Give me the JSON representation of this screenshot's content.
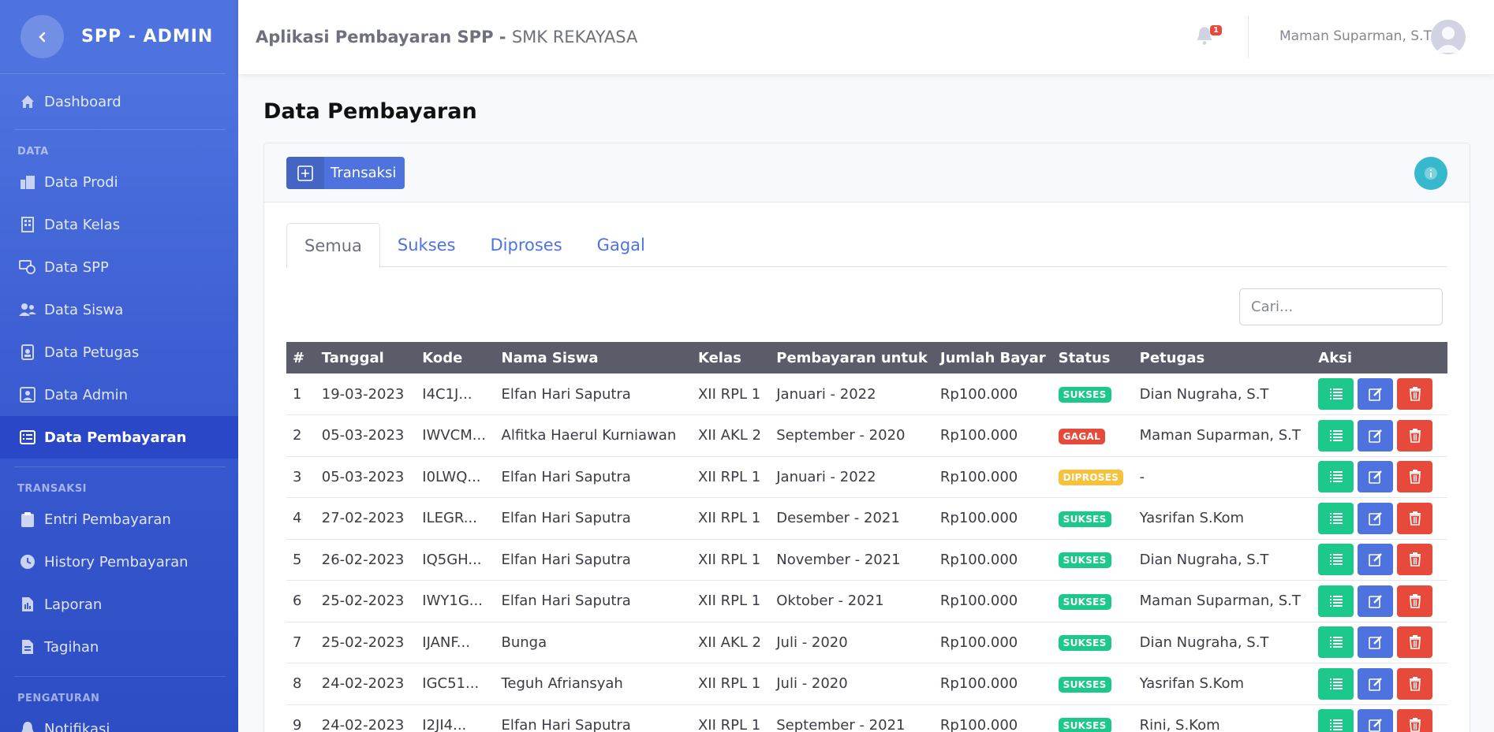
{
  "sidebar": {
    "brand": "SPP - ADMIN",
    "dashboard": "Dashboard",
    "heading_data": "DATA",
    "data_items": [
      "Data Prodi",
      "Data Kelas",
      "Data SPP",
      "Data Siswa",
      "Data Petugas",
      "Data Admin",
      "Data Pembayaran"
    ],
    "heading_transaksi": "TRANSAKSI",
    "transaksi_items": [
      "Entri Pembayaran",
      "History Pembayaran",
      "Laporan",
      "Tagihan"
    ],
    "heading_pengaturan": "PENGATURAN",
    "pengaturan_items": [
      "Notifikasi"
    ]
  },
  "topbar": {
    "app_title_bold": "Aplikasi Pembayaran SPP",
    "app_title_sep": " - ",
    "app_title_school": "SMK REKAYASA",
    "notification_count": "1",
    "username": "Maman Suparman, S.T"
  },
  "main": {
    "page_title": "Data Pembayaran",
    "transaksi_button": "Transaksi",
    "tabs": [
      "Semua",
      "Sukses",
      "Diproses",
      "Gagal"
    ],
    "search_placeholder": "Cari...",
    "columns": [
      "#",
      "Tanggal",
      "Kode",
      "Nama Siswa",
      "Kelas",
      "Pembayaran untuk",
      "Jumlah Bayar",
      "Status",
      "Petugas",
      "Aksi"
    ],
    "rows": [
      {
        "no": "1",
        "tanggal": "19-03-2023",
        "kode": "I4C1J...",
        "nama": "Elfan Hari Saputra",
        "kelas": "XII RPL 1",
        "untuk": "Januari - 2022",
        "jumlah": "Rp100.000",
        "status": "SUKSES",
        "petugas": "Dian Nugraha, S.T"
      },
      {
        "no": "2",
        "tanggal": "05-03-2023",
        "kode": "IWVCM...",
        "nama": "Alfitka Haerul Kurniawan",
        "kelas": "XII AKL 2",
        "untuk": "September - 2020",
        "jumlah": "Rp100.000",
        "status": "GAGAL",
        "petugas": "Maman Suparman, S.T"
      },
      {
        "no": "3",
        "tanggal": "05-03-2023",
        "kode": "I0LWQ...",
        "nama": "Elfan Hari Saputra",
        "kelas": "XII RPL 1",
        "untuk": "Januari - 2022",
        "jumlah": "Rp100.000",
        "status": "DIPROSES",
        "petugas": "-"
      },
      {
        "no": "4",
        "tanggal": "27-02-2023",
        "kode": "ILEGR...",
        "nama": "Elfan Hari Saputra",
        "kelas": "XII RPL 1",
        "untuk": "Desember - 2021",
        "jumlah": "Rp100.000",
        "status": "SUKSES",
        "petugas": "Yasrifan S.Kom"
      },
      {
        "no": "5",
        "tanggal": "26-02-2023",
        "kode": "IQ5GH...",
        "nama": "Elfan Hari Saputra",
        "kelas": "XII RPL 1",
        "untuk": "November - 2021",
        "jumlah": "Rp100.000",
        "status": "SUKSES",
        "petugas": "Dian Nugraha, S.T"
      },
      {
        "no": "6",
        "tanggal": "25-02-2023",
        "kode": "IWY1G...",
        "nama": "Elfan Hari Saputra",
        "kelas": "XII RPL 1",
        "untuk": "Oktober - 2021",
        "jumlah": "Rp100.000",
        "status": "SUKSES",
        "petugas": "Maman Suparman, S.T"
      },
      {
        "no": "7",
        "tanggal": "25-02-2023",
        "kode": "IJANF...",
        "nama": "Bunga",
        "kelas": "XII AKL 2",
        "untuk": "Juli - 2020",
        "jumlah": "Rp100.000",
        "status": "SUKSES",
        "petugas": "Dian Nugraha, S.T"
      },
      {
        "no": "8",
        "tanggal": "24-02-2023",
        "kode": "IGC51...",
        "nama": "Teguh Afriansyah",
        "kelas": "XII RPL 1",
        "untuk": "Juli - 2020",
        "jumlah": "Rp100.000",
        "status": "SUKSES",
        "petugas": "Yasrifan S.Kom"
      },
      {
        "no": "9",
        "tanggal": "24-02-2023",
        "kode": "I2JI4...",
        "nama": "Elfan Hari Saputra",
        "kelas": "XII RPL 1",
        "untuk": "September - 2021",
        "jumlah": "Rp100.000",
        "status": "SUKSES",
        "petugas": "Rini, S.Kom"
      }
    ]
  },
  "colors": {
    "primary": "#4e73df",
    "success": "#1cc88a",
    "danger": "#e74a3b",
    "warning": "#f6c23e",
    "info": "#36b9cc",
    "table_header": "#5a5c69"
  },
  "icons": {
    "sidebar_toggle": "chevron-left-icon",
    "dashboard": "home-icon",
    "notification": "bell-icon",
    "info": "info-circle-icon",
    "detail": "list-icon",
    "edit": "edit-icon",
    "delete": "trash-icon"
  }
}
